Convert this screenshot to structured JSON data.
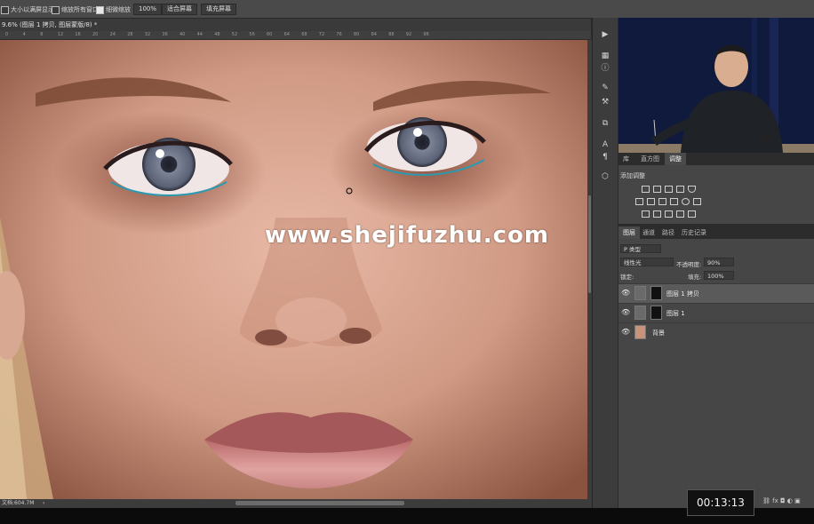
{
  "options_bar": {
    "resize_windows_label": "大小以满屏显示",
    "zoom_all_windows_label": "缩放所有窗口",
    "scrubby_zoom_label": "细微缩放",
    "zoom_100_label": "100%",
    "fit_screen_label": "适合屏幕",
    "fill_screen_label": "填充屏幕"
  },
  "document": {
    "tab_title": "9.6% (图层 1 拷贝, 图层蒙版/8) *",
    "status_text": "文档:604.7M",
    "ruler_ticks": [
      "0",
      "4",
      "8",
      "12",
      "16",
      "20",
      "24",
      "28",
      "32",
      "36",
      "40",
      "44",
      "48",
      "52",
      "56",
      "60",
      "64",
      "68",
      "72",
      "76",
      "80",
      "84",
      "88",
      "92",
      "96"
    ]
  },
  "watermark": "www.shejifuzhu.com",
  "timer": "00:13:13",
  "panels": {
    "top_tabs": [
      "库",
      "直方图",
      "调整"
    ],
    "active_top_tab": "调整",
    "adjustments_title": "添加调整",
    "bottom_tabs": [
      "图层",
      "通道",
      "路径",
      "历史记录"
    ],
    "active_bottom_tab": "图层",
    "filter_kind": "P 类型",
    "blend_mode": "线性光",
    "opacity_label": "不透明度:",
    "opacity_value": "90%",
    "lock_label": "锁定:",
    "fill_label": "填充:",
    "fill_value": "100%"
  },
  "layers": [
    {
      "name": "图层 1 拷贝",
      "selected": true
    },
    {
      "name": "图层 1",
      "selected": false
    },
    {
      "name": "背景",
      "selected": false
    }
  ],
  "colors": {
    "ui_dark": "#2b2b2b",
    "panel_gray": "#464646",
    "selected_row": "#5a5a5a"
  }
}
